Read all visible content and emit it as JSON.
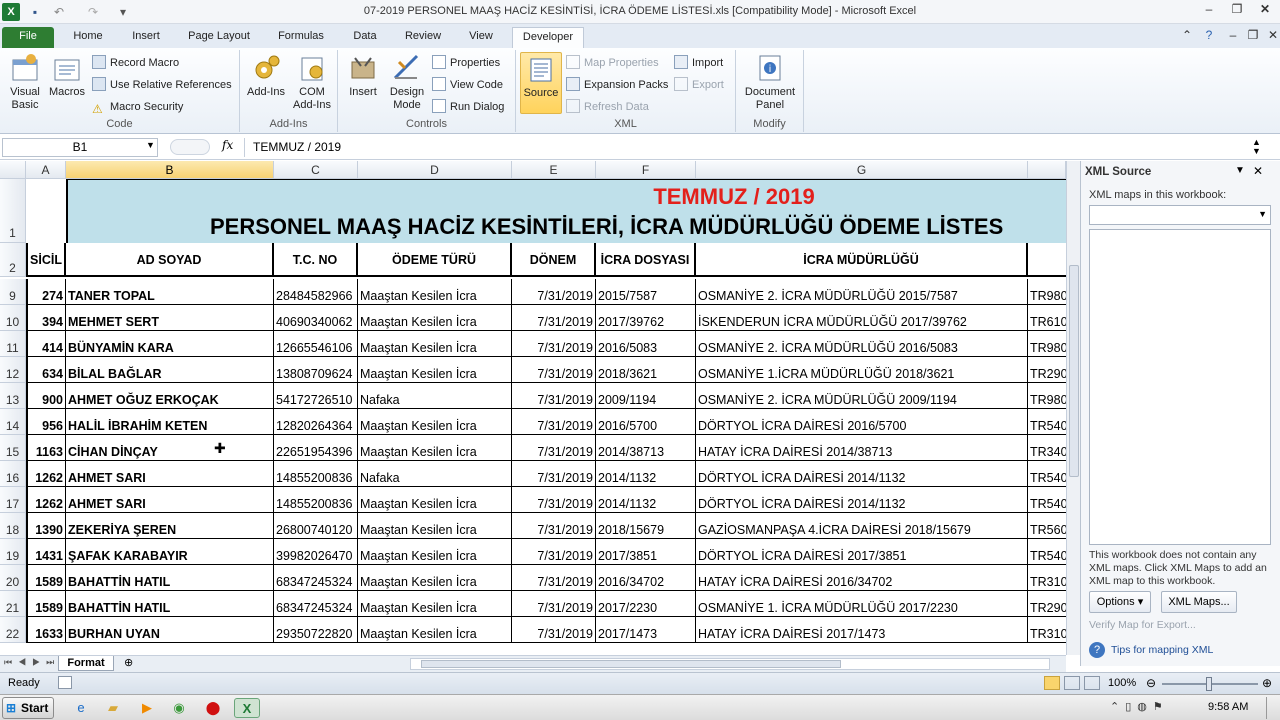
{
  "window": {
    "title": "07-2019 PERSONEL MAAŞ HACİZ KESİNTİSİ, İCRA ÖDEME LİSTESİ.xls  [Compatibility Mode]  -  Microsoft Excel"
  },
  "tabs": [
    "File",
    "Home",
    "Insert",
    "Page Layout",
    "Formulas",
    "Data",
    "Review",
    "View",
    "Developer"
  ],
  "ribbon": {
    "code": {
      "label": "Code",
      "visual_basic": "Visual\nBasic",
      "macros": "Macros",
      "record_macro": "Record Macro",
      "relative_refs": "Use Relative References",
      "macro_security": "Macro Security"
    },
    "addins": {
      "label": "Add-Ins",
      "addins": "Add-Ins",
      "com_addins": "COM\nAdd-Ins"
    },
    "controls": {
      "label": "Controls",
      "insert": "Insert",
      "design_mode": "Design\nMode",
      "properties": "Properties",
      "view_code": "View Code",
      "run_dialog": "Run Dialog"
    },
    "xml": {
      "label": "XML",
      "source": "Source",
      "map_properties": "Map Properties",
      "expansion_packs": "Expansion Packs",
      "refresh_data": "Refresh Data",
      "import": "Import",
      "export": "Export"
    },
    "modify": {
      "label": "Modify",
      "document_panel": "Document\nPanel"
    }
  },
  "formula_bar": {
    "name_box": "B1",
    "fx": "fx",
    "value": "TEMMUZ / 2019"
  },
  "columns": [
    "A",
    "B",
    "C",
    "D",
    "E",
    "F",
    "G"
  ],
  "sheet": {
    "title1": "TEMMUZ / 2019",
    "title2": "PERSONEL MAAŞ HACİZ KESİNTİLERİ, İCRA MÜDÜRLÜĞÜ ÖDEME LİSTES",
    "headers": [
      "SİCİL",
      "AD SOYAD",
      "T.C. NO",
      "ÖDEME TÜRÜ",
      "DÖNEM",
      "İCRA DOSYASI",
      "İCRA MÜDÜRLÜĞÜ"
    ],
    "row_numbers_top": [
      "1",
      "2"
    ],
    "rows": [
      {
        "n": "9",
        "sicil": "274",
        "name": "TANER TOPAL",
        "tc": "28484582966",
        "type": "Maaştan Kesilen İcra",
        "period": "7/31/2019",
        "file": "2015/7587",
        "office": "OSMANİYE 2. İCRA MÜDÜRLÜĞÜ 2015/7587",
        "iban": "TR980"
      },
      {
        "n": "10",
        "sicil": "394",
        "name": "MEHMET SERT",
        "tc": "40690340062",
        "type": "Maaştan Kesilen İcra",
        "period": "7/31/2019",
        "file": "2017/39762",
        "office": "İSKENDERUN İCRA MÜDÜRLÜĞÜ 2017/39762",
        "iban": "TR610"
      },
      {
        "n": "11",
        "sicil": "414",
        "name": "BÜNYAMİN KARA",
        "tc": "12665546106",
        "type": "Maaştan Kesilen İcra",
        "period": "7/31/2019",
        "file": "2016/5083",
        "office": "OSMANİYE 2. İCRA MÜDÜRLÜĞÜ 2016/5083",
        "iban": "TR980"
      },
      {
        "n": "12",
        "sicil": "634",
        "name": "BİLAL BAĞLAR",
        "tc": "13808709624",
        "type": "Maaştan Kesilen İcra",
        "period": "7/31/2019",
        "file": "2018/3621",
        "office": "OSMANİYE 1.İCRA MÜDÜRLÜĞÜ 2018/3621",
        "iban": "TR290"
      },
      {
        "n": "13",
        "sicil": "900",
        "name": "AHMET OĞUZ ERKOÇAK",
        "tc": "54172726510",
        "type": "Nafaka",
        "period": "7/31/2019",
        "file": "2009/1194",
        "office": "OSMANİYE 2. İCRA MÜDÜRLÜĞÜ 2009/1194",
        "iban": "TR980"
      },
      {
        "n": "14",
        "sicil": "956",
        "name": "HALİL İBRAHİM KETEN",
        "tc": "12820264364",
        "type": "Maaştan Kesilen İcra",
        "period": "7/31/2019",
        "file": "2016/5700",
        "office": "DÖRTYOL İCRA DAİRESİ 2016/5700",
        "iban": "TR540"
      },
      {
        "n": "15",
        "sicil": "1163",
        "name": "CİHAN DİNÇAY",
        "tc": "22651954396",
        "type": "Maaştan Kesilen İcra",
        "period": "7/31/2019",
        "file": "2014/38713",
        "office": "HATAY İCRA DAİRESİ 2014/38713",
        "iban": "TR340"
      },
      {
        "n": "16",
        "sicil": "1262",
        "name": "AHMET SARI",
        "tc": "14855200836",
        "type": "Nafaka",
        "period": "7/31/2019",
        "file": "2014/1132",
        "office": "DÖRTYOL İCRA DAİRESİ 2014/1132",
        "iban": "TR540"
      },
      {
        "n": "17",
        "sicil": "1262",
        "name": "AHMET SARI",
        "tc": "14855200836",
        "type": "Maaştan Kesilen İcra",
        "period": "7/31/2019",
        "file": "2014/1132",
        "office": "DÖRTYOL İCRA DAİRESİ 2014/1132",
        "iban": "TR540"
      },
      {
        "n": "18",
        "sicil": "1390",
        "name": "ZEKERİYA ŞEREN",
        "tc": "26800740120",
        "type": "Maaştan Kesilen İcra",
        "period": "7/31/2019",
        "file": "2018/15679",
        "office": "GAZİOSMANPAŞA 4.İCRA DAİRESİ 2018/15679",
        "iban": "TR560"
      },
      {
        "n": "19",
        "sicil": "1431",
        "name": "ŞAFAK KARABAYIR",
        "tc": "39982026470",
        "type": "Maaştan Kesilen İcra",
        "period": "7/31/2019",
        "file": "2017/3851",
        "office": "DÖRTYOL İCRA DAİRESİ 2017/3851",
        "iban": "TR540"
      },
      {
        "n": "20",
        "sicil": "1589",
        "name": "BAHATTİN HATIL",
        "tc": "68347245324",
        "type": "Maaştan Kesilen İcra",
        "period": "7/31/2019",
        "file": "2016/34702",
        "office": "HATAY İCRA DAİRESİ 2016/34702",
        "iban": "TR310"
      },
      {
        "n": "21",
        "sicil": "1589",
        "name": "BAHATTİN HATIL",
        "tc": "68347245324",
        "type": "Maaştan Kesilen İcra",
        "period": "7/31/2019",
        "file": "2017/2230",
        "office": "OSMANİYE 1. İCRA MÜDÜRLÜĞÜ 2017/2230",
        "iban": "TR290"
      },
      {
        "n": "22",
        "sicil": "1633",
        "name": "BURHAN UYAN",
        "tc": "29350722820",
        "type": "Maaştan Kesilen İcra",
        "period": "7/31/2019",
        "file": "2017/1473",
        "office": "HATAY İCRA DAİRESİ 2017/1473",
        "iban": "TR310"
      }
    ]
  },
  "xml_source": {
    "title": "XML Source",
    "maps_label": "XML maps in this workbook:",
    "message": "This workbook does not contain any XML maps. Click XML Maps to add an XML map to this workbook.",
    "options": "Options ▾",
    "xml_maps": "XML Maps...",
    "verify": "Verify Map for Export...",
    "tips": "Tips for mapping XML"
  },
  "sheet_tabs": {
    "active": "Format"
  },
  "status": {
    "ready": "Ready",
    "zoom": "100%"
  },
  "taskbar": {
    "start": "Start",
    "time": "9:58 AM"
  },
  "colors": {
    "accent": "#2e7d32",
    "title_red": "#e3201b",
    "header_fill": "#bfe0ea"
  }
}
